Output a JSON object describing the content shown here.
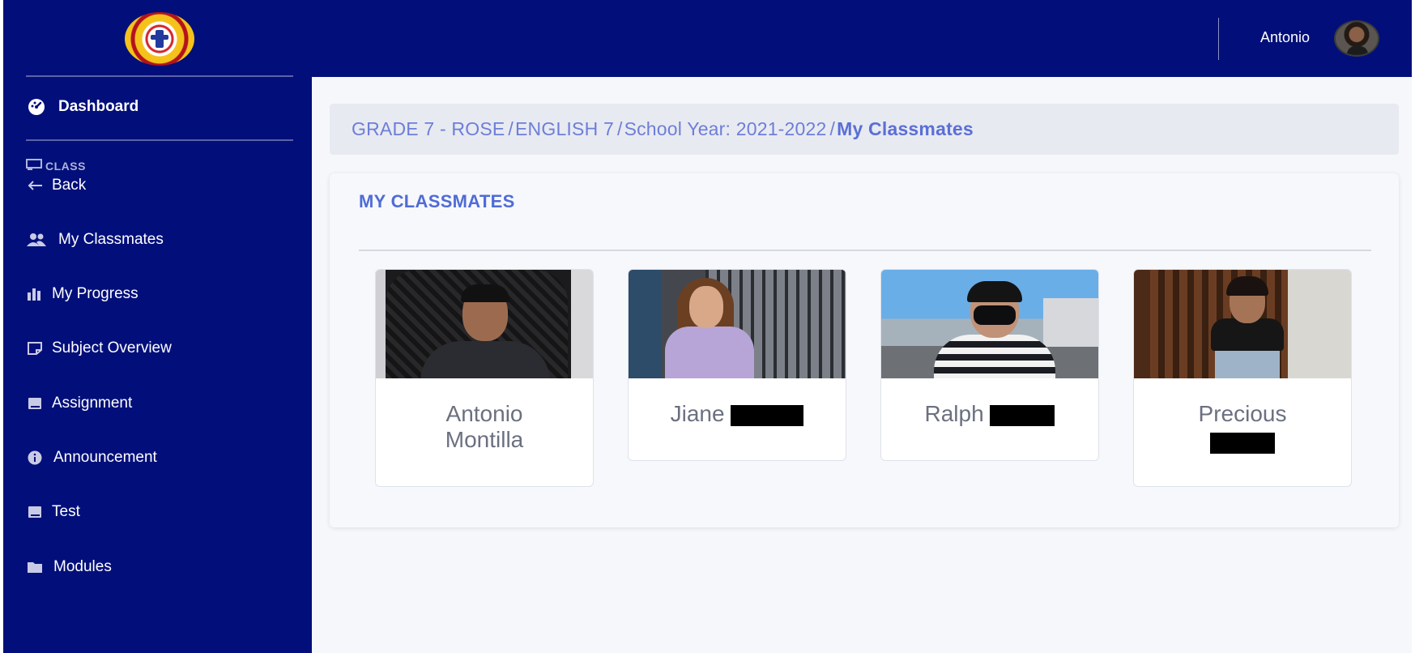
{
  "header": {
    "user_name": "Antonio"
  },
  "sidebar": {
    "items": [
      {
        "label": "Dashboard",
        "icon": "dashboard-icon"
      },
      {
        "label": "Back",
        "icon": "arrow-left-icon"
      },
      {
        "label": "My Classmates",
        "icon": "users-icon"
      },
      {
        "label": "My Progress",
        "icon": "bar-chart-icon"
      },
      {
        "label": "Subject Overview",
        "icon": "sticky-note-icon"
      },
      {
        "label": "Assignment",
        "icon": "book-icon"
      },
      {
        "label": "Announcement",
        "icon": "info-icon"
      },
      {
        "label": "Test",
        "icon": "book-icon"
      },
      {
        "label": "Modules",
        "icon": "folder-icon"
      }
    ],
    "section_label": "CLASS"
  },
  "breadcrumb": {
    "items": [
      "GRADE 7 - ROSE",
      "ENGLISH 7",
      "School Year: 2021-2022"
    ],
    "active": "My Classmates",
    "separator": "/"
  },
  "classmates": {
    "title": "MY CLASSMATES",
    "people": [
      {
        "first": "Antonio",
        "last": "Montilla"
      },
      {
        "first": "Jiane",
        "last": ""
      },
      {
        "first": "Ralph",
        "last": ""
      },
      {
        "first": "Precious",
        "last": ""
      }
    ]
  },
  "colors": {
    "navy": "#020f7a",
    "accent": "#4f6cd6",
    "breadcrumb_text": "#6d7ed8",
    "main_bg": "#f6f7fb"
  }
}
